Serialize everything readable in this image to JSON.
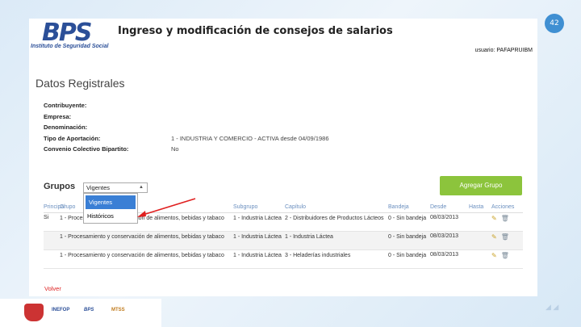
{
  "slide_number": "42",
  "header": {
    "logo": "BPS",
    "logo_subtitle": "Instituto de Seguridad Social",
    "title": "Ingreso y modificación de consejos de salarios",
    "user": "usuario: PAFAPRUIBM"
  },
  "section_title": "Datos Registrales",
  "fields": [
    {
      "label": "Contribuyente:",
      "value": ""
    },
    {
      "label": "Empresa:",
      "value": ""
    },
    {
      "label": "Denominación:",
      "value": ""
    },
    {
      "label": "Tipo de Aportación:",
      "value": "1 - INDUSTRIA Y COMERCIO - ACTIVA desde 04/09/1986"
    },
    {
      "label": "Convenio Colectivo Bipartito:",
      "value": "No"
    }
  ],
  "grupos": {
    "title": "Grupos",
    "select_value": "Vigentes",
    "options": [
      "Vigentes",
      "Históricos"
    ],
    "add_button": "Agregar Grupo"
  },
  "table": {
    "headers": [
      "Principal",
      "Grupo",
      "Subgrupo",
      "Capítulo",
      "Bandeja",
      "Desde",
      "Hasta",
      "Acciones"
    ],
    "rows": [
      {
        "principal": "Si",
        "grupo": "1 - Procesamiento y conservación de alimentos, bebidas y tabaco",
        "subgrupo": "1 - Industria Láctea",
        "capitulo": "2 - Distribuidores de Productos Lácteos",
        "bandeja": "0 - Sin bandeja",
        "desde": "08/03/2013",
        "hasta": ""
      },
      {
        "principal": "",
        "grupo": "1 - Procesamiento y conservación de alimentos, bebidas y tabaco",
        "subgrupo": "1 - Industria Láctea",
        "capitulo": "1 - Industria Láctea",
        "bandeja": "0 - Sin bandeja",
        "desde": "08/03/2013",
        "hasta": ""
      },
      {
        "principal": "",
        "grupo": "1 - Procesamiento y conservación de alimentos, bebidas y tabaco",
        "subgrupo": "1 - Industria Láctea",
        "capitulo": "3 - Heladerías industriales",
        "bandeja": "0 - Sin bandeja",
        "desde": "08/03/2013",
        "hasta": ""
      }
    ]
  },
  "volver": "Volver",
  "footer_logos": [
    "INEFOP",
    "BPS",
    "MTSS"
  ],
  "colors": {
    "accent_blue": "#3f8fd2",
    "button_green": "#8cc43c",
    "link_red": "#d22222",
    "arrow_red": "#e02020"
  }
}
